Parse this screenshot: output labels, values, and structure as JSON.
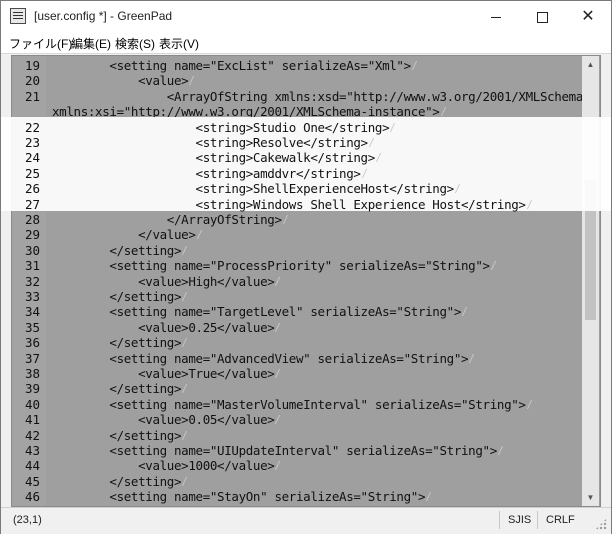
{
  "window": {
    "title": "[user.config *] - GreenPad"
  },
  "menu": {
    "items": [
      "ファイル(F)",
      "編集(E)",
      "検索(S)",
      "表示(V)"
    ]
  },
  "editor": {
    "lines": [
      {
        "num": "19",
        "text": "        <setting name=\"ExcList\" serializeAs=\"Xml\">"
      },
      {
        "num": "20",
        "text": "            <value>"
      },
      {
        "num": "21",
        "text": "                <ArrayOfString xmlns:xsd=\"http://www.w3.org/2001/XMLSchema\""
      },
      {
        "num": "",
        "text": "xmlns:xsi=\"http://www.w3.org/2001/XMLSchema-instance\">"
      },
      {
        "num": "22",
        "text": "                    <string>Studio One</string>"
      },
      {
        "num": "23",
        "text": "                    <string>Resolve</string>"
      },
      {
        "num": "24",
        "text": "                    <string>Cakewalk</string>"
      },
      {
        "num": "25",
        "text": "                    <string>amddvr</string>"
      },
      {
        "num": "26",
        "text": "                    <string>ShellExperienceHost</string>"
      },
      {
        "num": "27",
        "text": "                    <string>Windows Shell Experience Host</string>"
      },
      {
        "num": "28",
        "text": "                </ArrayOfString>"
      },
      {
        "num": "29",
        "text": "            </value>"
      },
      {
        "num": "30",
        "text": "        </setting>"
      },
      {
        "num": "31",
        "text": "        <setting name=\"ProcessPriority\" serializeAs=\"String\">"
      },
      {
        "num": "32",
        "text": "            <value>High</value>"
      },
      {
        "num": "33",
        "text": "        </setting>"
      },
      {
        "num": "34",
        "text": "        <setting name=\"TargetLevel\" serializeAs=\"String\">"
      },
      {
        "num": "35",
        "text": "            <value>0.25</value>"
      },
      {
        "num": "36",
        "text": "        </setting>"
      },
      {
        "num": "37",
        "text": "        <setting name=\"AdvancedView\" serializeAs=\"String\">"
      },
      {
        "num": "38",
        "text": "            <value>True</value>"
      },
      {
        "num": "39",
        "text": "        </setting>"
      },
      {
        "num": "40",
        "text": "        <setting name=\"MasterVolumeInterval\" serializeAs=\"String\">"
      },
      {
        "num": "41",
        "text": "            <value>0.05</value>"
      },
      {
        "num": "42",
        "text": "        </setting>"
      },
      {
        "num": "43",
        "text": "        <setting name=\"UIUpdateInterval\" serializeAs=\"String\">"
      },
      {
        "num": "44",
        "text": "            <value>1000</value>"
      },
      {
        "num": "45",
        "text": "        </setting>"
      },
      {
        "num": "46",
        "text": "        <setting name=\"StayOn\" serializeAs=\"String\">"
      }
    ],
    "highlighted_lines": [
      "22",
      "23",
      "24",
      "25",
      "26",
      "27"
    ]
  },
  "statusbar": {
    "position": "(23,1)",
    "encoding": "SJIS",
    "line_ending": "CRLF"
  },
  "colors": {
    "editor_background": "#9f9f9f",
    "highlight_band": "#ffffff"
  }
}
